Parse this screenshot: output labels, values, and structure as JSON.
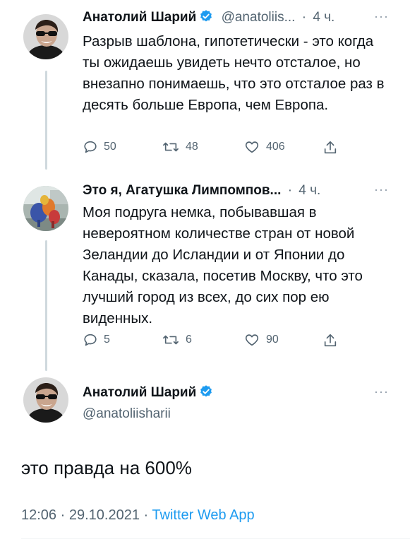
{
  "tweet1": {
    "author_name": "Анатолий Шарий",
    "handle": "@anatoliis...",
    "separator": "·",
    "time": "4 ч.",
    "more": "···",
    "text": "Разрыв шаблона, гипотетически - это когда ты ожидаешь увидеть нечто отсталое, но внезапно понимаешь, что это отсталое раз в десять больше Европа, чем Европа.",
    "replies": "50",
    "retweets": "48",
    "likes": "406"
  },
  "tweet2": {
    "author_name": "Это я, Агатушка Лимпомпов...",
    "separator": "·",
    "time": "4 ч.",
    "more": "···",
    "text": "Моя подруга немка, побывавшая в невероятном количестве стран от новой Зеландии до Исландии и от Японии до Канады, сказала, посетив Москву, что это лучший город из всех, до сих пор ею виденных.",
    "replies": "5",
    "retweets": "6",
    "likes": "90"
  },
  "main_tweet": {
    "author_name": "Анатолий Шарий",
    "handle": "@anatoliisharii",
    "more": "···",
    "text": "это правда на 600%",
    "time": "12:06",
    "separator": "·",
    "date": "29.10.2021",
    "source": "Twitter Web App"
  },
  "colors": {
    "verified": "#1d9bf0",
    "muted": "#536471",
    "link": "#1d9bf0",
    "thread_line": "#cfd9de"
  },
  "icons": [
    "verified-badge-icon",
    "reply-icon",
    "retweet-icon",
    "like-icon",
    "share-icon",
    "more-icon"
  ]
}
